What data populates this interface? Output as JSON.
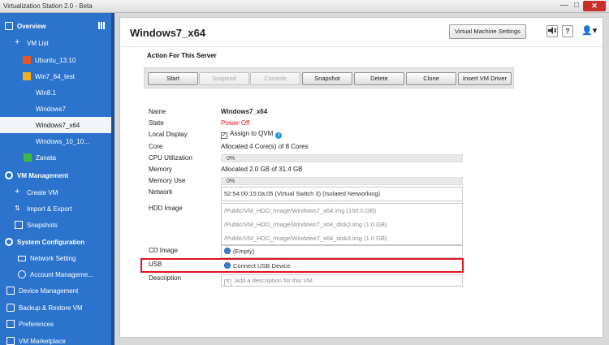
{
  "window": {
    "title": "Virtualization Station 2.0 - Beta",
    "min_glyph": "—",
    "max_glyph": "□",
    "close_glyph": "✕"
  },
  "sidebar": {
    "overview": "Overview",
    "vm_list": "VM List",
    "vms": [
      {
        "label": "Ubuntu_13.10",
        "icon": "ubuntu-icon"
      },
      {
        "label": "Win7_64_test",
        "icon": "vm-icon"
      },
      {
        "label": "Win8.1",
        "icon": "windows-icon"
      },
      {
        "label": "Windows7",
        "icon": "windows-icon"
      },
      {
        "label": "Windows7_x64",
        "icon": "windows-icon",
        "selected": true
      },
      {
        "label": "Windows_10_10...",
        "icon": "windows-icon"
      },
      {
        "label": "Zanata",
        "icon": "vm-icon"
      }
    ],
    "vm_management": "VM Management",
    "create_vm": "Create VM",
    "import_export": "Import & Export",
    "snapshots": "Snapshots",
    "system_configuration": "System Configuration",
    "network_setting": "Network Setting",
    "account_management": "Account Manageme...",
    "device_management": "Device Management",
    "backup_restore": "Backup & Restore VM",
    "preferences": "Preferences",
    "vm_marketplace": "VM Marketplace"
  },
  "header": {
    "title": "Windows7_x64",
    "vm_settings_label": "Virtual Machine Settings",
    "user_glyph": "👤▾"
  },
  "actions": {
    "title": "Action For This Server",
    "buttons": [
      "Start",
      "Suspend",
      "Console",
      "Snapshot",
      "Delete",
      "Clone",
      "Insert VM Driver"
    ]
  },
  "details": {
    "name_label": "Name",
    "name_value": "Windows7_x64",
    "state_label": "State",
    "state_value": "Power Off",
    "local_display_label": "Local Display",
    "local_display_value": "Assign to QVM",
    "core_label": "Core",
    "core_value": "Allocated 4 Core(s) of 8 Cores",
    "cpu_label": "CPU Utilization",
    "cpu_value": "0%",
    "memory_label": "Memory",
    "memory_value": "Allocated 2.0 GB of 31.4 GB",
    "memory_use_label": "Memory Use",
    "memory_use_value": "0%",
    "network_label": "Network",
    "network_value": "52:54:00:15:0a:05 (Virtual Switch 3) (Isolated Networking)",
    "hdd_label": "HDD Image",
    "hdd_images": [
      "/Public/VM_HDD_Image/Windows7_x64.img (150.0 GB)",
      "/Public/VM_HDD_Image/Windows7_x64_disk2.img (1.0 GB)",
      "/Public/VM_HDD_Image/Windows7_x64_disk3.img (1.0 GB)"
    ],
    "cd_label": "CD Image",
    "cd_value": "(Empty)",
    "usb_label": "USB",
    "usb_value": "Connect USB Device",
    "description_label": "Description",
    "description_placeholder": "Add a description for this VM"
  },
  "colors": {
    "sidebar": "#2b73cc",
    "state_off": "#e0131e",
    "highlight": "#e0131e"
  }
}
